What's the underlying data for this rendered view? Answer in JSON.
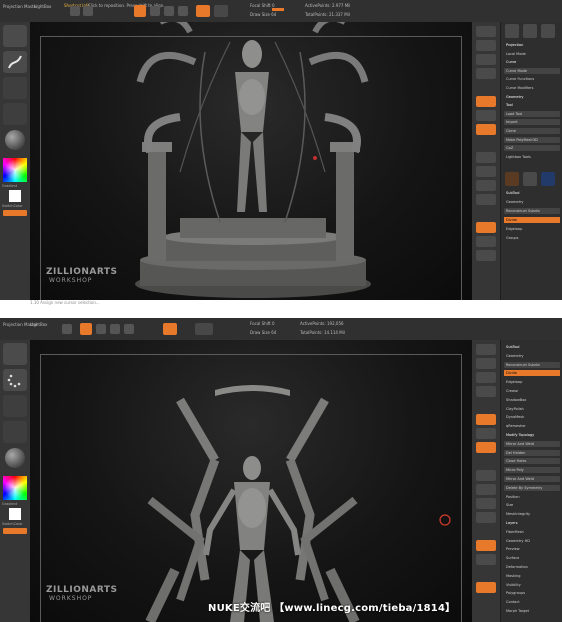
{
  "top_panel": {
    "toolbar": {
      "projection_label": "Projection Master",
      "lightbox_label": "LightBox",
      "hint_warning": "Shortcut Info",
      "hint_text": "Click to reposition. Press shift to align.",
      "focal_shift": "Focal Shift 0",
      "draw_size": "Draw Size 64",
      "active_points": "ActivePoints: 2.977 Mil",
      "total_points": "TotalPoints: 21.337 Mil"
    },
    "palette": [
      {
        "label": "Projection",
        "style": "hdr"
      },
      {
        "label": "Local Mode",
        "style": "plain"
      },
      {
        "label": "Curve",
        "style": "hdr"
      },
      {
        "label": "Curve Mode",
        "style": "btn"
      },
      {
        "label": "Curve Functions",
        "style": "plain"
      },
      {
        "label": "Curve Modifiers",
        "style": "plain"
      },
      {
        "label": "Geometry",
        "style": "hdr"
      },
      {
        "label": "Tool",
        "style": "hdr"
      },
      {
        "label": "Load Tool",
        "style": "btn"
      },
      {
        "label": "Import",
        "style": "btn"
      },
      {
        "label": "Clone",
        "style": "btn"
      },
      {
        "label": "Make PolyMesh3D",
        "style": "btn"
      },
      {
        "label": "GoZ",
        "style": "btn"
      },
      {
        "label": "Lightbox Tools",
        "style": "plain"
      },
      {
        "label": "SubTool",
        "style": "hdr"
      },
      {
        "label": "Geometry",
        "style": "plain"
      },
      {
        "label": "Reconstruct Subdiv",
        "style": "btn"
      },
      {
        "label": "Divide",
        "style": "orange"
      },
      {
        "label": "Edgeloop",
        "style": "plain"
      },
      {
        "label": "Groups",
        "style": "plain"
      }
    ],
    "small_labels": [
      "Gradient",
      "SwitchColor",
      "Alternate"
    ],
    "footer_text": "1.10 Assign new cursor selection..."
  },
  "bottom_panel": {
    "toolbar": {
      "projection_label": "Projection Master",
      "lightbox_label": "LightBox",
      "focal_shift": "Focal Shift 0",
      "draw_size": "Draw Size 64",
      "active_points": "ActivePoints: 192,056",
      "total_points": "TotalPoints: 14.114 Mil"
    },
    "palette": [
      {
        "label": "SubTool",
        "style": "hdr"
      },
      {
        "label": "Geometry",
        "style": "plain"
      },
      {
        "label": "Reconstruct Subdiv",
        "style": "btn"
      },
      {
        "label": "Divide",
        "style": "orange"
      },
      {
        "label": "Edgeloop",
        "style": "plain"
      },
      {
        "label": "Crease",
        "style": "plain"
      },
      {
        "label": "ShadowBox",
        "style": "plain"
      },
      {
        "label": "ClayPolish",
        "style": "plain"
      },
      {
        "label": "DynaMesh",
        "style": "plain"
      },
      {
        "label": "qRemesher",
        "style": "plain"
      },
      {
        "label": "Modify Topology",
        "style": "hdr"
      },
      {
        "label": "Mirror And Weld",
        "style": "btn"
      },
      {
        "label": "Del Hidden",
        "style": "btn"
      },
      {
        "label": "Close Holes",
        "style": "btn"
      },
      {
        "label": "Micro Poly",
        "style": "btn"
      },
      {
        "label": "Mirror And Weld",
        "style": "btn"
      },
      {
        "label": "Delete By Symmetry",
        "style": "btn"
      },
      {
        "label": "Position",
        "style": "plain"
      },
      {
        "label": "Size",
        "style": "plain"
      },
      {
        "label": "MeshIntegrity",
        "style": "plain"
      },
      {
        "label": "Layers",
        "style": "hdr"
      },
      {
        "label": "FiberMesh",
        "style": "plain"
      },
      {
        "label": "Geometry HD",
        "style": "plain"
      },
      {
        "label": "Preview",
        "style": "plain"
      },
      {
        "label": "Surface",
        "style": "plain"
      },
      {
        "label": "Deformation",
        "style": "plain"
      },
      {
        "label": "Masking",
        "style": "plain"
      },
      {
        "label": "Visibility",
        "style": "plain"
      },
      {
        "label": "Polygroups",
        "style": "plain"
      },
      {
        "label": "Contact",
        "style": "plain"
      },
      {
        "label": "Morph Target",
        "style": "plain"
      }
    ],
    "small_labels": [
      "Gradient",
      "SwitchColor",
      "Alternate"
    ]
  },
  "logo": {
    "line1": "ZILLIONARTS",
    "line2": "WORKSHOP"
  },
  "watermark": "NUKE交流吧 【www.linecg.com/tieba/1814】",
  "colors": {
    "accent": "#e8782a",
    "panel_bg": "#2b2b2b",
    "canvas_bg": "#151515",
    "warn": "#f2b640"
  }
}
